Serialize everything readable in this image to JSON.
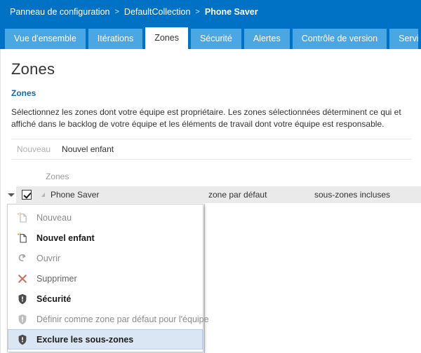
{
  "header": {
    "breadcrumb": [
      {
        "label": "Panneau de configuration",
        "current": false
      },
      {
        "label": "DefaultCollection",
        "current": false
      },
      {
        "label": "Phone Saver",
        "current": true
      }
    ],
    "separator": ">",
    "bar_color": "#0072c6"
  },
  "tabs": [
    {
      "label": "Vue d'ensemble",
      "active": false
    },
    {
      "label": "Itérations",
      "active": false
    },
    {
      "label": "Zones",
      "active": true
    },
    {
      "label": "Sécurité",
      "active": false
    },
    {
      "label": "Alertes",
      "active": false
    },
    {
      "label": "Contrôle de version",
      "active": false
    },
    {
      "label": "Servi...",
      "active": false
    }
  ],
  "main": {
    "page_title": "Zones",
    "section_link": "Zones",
    "description": "Sélectionnez les zones dont votre équipe est propriétaire. Les zones sélectionnées déterminent ce qui et affiché dans le backlog de votre équipe et les éléments de travail dont votre équipe est responsable.",
    "link_color": "#1267b5"
  },
  "toolbar": {
    "items": [
      {
        "label": "Nouveau",
        "disabled": true
      },
      {
        "label": "Nouvel enfant",
        "disabled": false
      }
    ]
  },
  "grid": {
    "columns": [
      "Zones",
      "",
      ""
    ],
    "header_label": "Zones",
    "row": {
      "name": "Phone Saver",
      "checked": true,
      "expanded": true,
      "default_area": "zone par défaut",
      "sub_areas": "sous-zones incluses"
    }
  },
  "context_menu": {
    "items": [
      {
        "label": "Nouveau",
        "icon": "new-document-icon",
        "state": "disabled"
      },
      {
        "label": "Nouvel enfant",
        "icon": "new-child-document-icon",
        "state": "enabled"
      },
      {
        "label": "Ouvrir",
        "icon": "open-arrow-icon",
        "state": "disabled"
      },
      {
        "label": "Supprimer",
        "icon": "delete-x-icon",
        "state": "disabled"
      },
      {
        "label": "Sécurité",
        "icon": "shield-icon",
        "state": "enabled"
      },
      {
        "label": "Définir comme zone par défaut pour l'équipe",
        "icon": "shield-icon",
        "state": "disabled"
      },
      {
        "label": "Exclure les sous-zones",
        "icon": "shield-icon",
        "state": "selected"
      }
    ],
    "highlight_color": "#dbe6f4",
    "highlight_border_color": "#b8cce4"
  }
}
